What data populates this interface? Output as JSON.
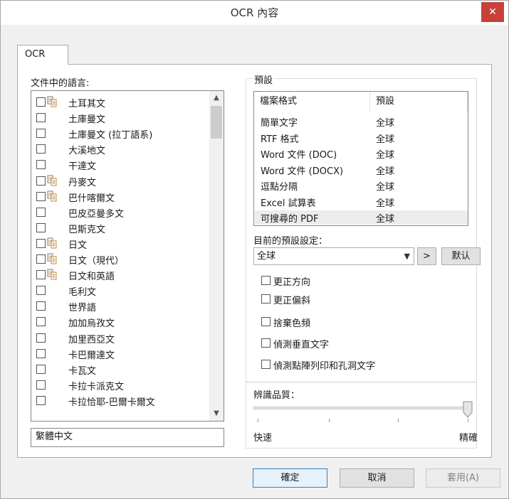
{
  "window": {
    "title": "OCR 內容"
  },
  "tabs": [
    {
      "label": "OCR"
    }
  ],
  "language_section": {
    "label": "文件中的語言:",
    "languages": [
      {
        "name": "土耳其文",
        "checked": false,
        "ocr_icon": true
      },
      {
        "name": "土庫曼文",
        "checked": false,
        "ocr_icon": false
      },
      {
        "name": "土庫曼文 (拉丁語系)",
        "checked": false,
        "ocr_icon": false
      },
      {
        "name": "大溪地文",
        "checked": false,
        "ocr_icon": false
      },
      {
        "name": "干達文",
        "checked": false,
        "ocr_icon": false
      },
      {
        "name": "丹麥文",
        "checked": false,
        "ocr_icon": true
      },
      {
        "name": "巴什喀爾文",
        "checked": false,
        "ocr_icon": true
      },
      {
        "name": "巴皮亞曼多文",
        "checked": false,
        "ocr_icon": false
      },
      {
        "name": "巴斯克文",
        "checked": false,
        "ocr_icon": false
      },
      {
        "name": "日文",
        "checked": false,
        "ocr_icon": true
      },
      {
        "name": "日文（現代）",
        "checked": false,
        "ocr_icon": true
      },
      {
        "name": "日文和英語",
        "checked": false,
        "ocr_icon": true
      },
      {
        "name": "毛利文",
        "checked": false,
        "ocr_icon": false
      },
      {
        "name": "世界語",
        "checked": false,
        "ocr_icon": false
      },
      {
        "name": "加加烏孜文",
        "checked": false,
        "ocr_icon": false
      },
      {
        "name": "加里西亞文",
        "checked": false,
        "ocr_icon": false
      },
      {
        "name": "卡巴爾達文",
        "checked": false,
        "ocr_icon": false
      },
      {
        "name": "卡瓦文",
        "checked": false,
        "ocr_icon": false
      },
      {
        "name": "卡拉卡派克文",
        "checked": false,
        "ocr_icon": false
      },
      {
        "name": "卡拉恰耶-巴爾卡爾文",
        "checked": false,
        "ocr_icon": false
      }
    ],
    "selected_languages": "繁體中文"
  },
  "preset_section": {
    "legend": "預設",
    "table": {
      "headers": [
        "檔案格式",
        "預設"
      ],
      "rows": [
        {
          "format": "簡單文字",
          "preset": "全球"
        },
        {
          "format": "RTF 格式",
          "preset": "全球"
        },
        {
          "format": "Word 文件 (DOC)",
          "preset": "全球"
        },
        {
          "format": "Word 文件 (DOCX)",
          "preset": "全球"
        },
        {
          "format": "逗點分隔",
          "preset": "全球"
        },
        {
          "format": "Excel 試算表",
          "preset": "全球"
        },
        {
          "format": "可搜尋的 PDF",
          "preset": "全球"
        }
      ],
      "selected_row": 6
    },
    "current_label": "目前的預設設定：",
    "current_value": "全球",
    "next_button": ">",
    "default_button": "默认",
    "options": [
      {
        "label": "更正方向",
        "checked": false
      },
      {
        "label": "更正偏斜",
        "checked": false
      },
      {
        "label": "捨棄色頻",
        "checked": false
      },
      {
        "label": "偵測垂直文字",
        "checked": false
      },
      {
        "label": "偵測點陣列印和孔洞文字",
        "checked": false
      }
    ],
    "quality": {
      "label": "辨識品質：",
      "min_label": "快速",
      "max_label": "精確",
      "value_fraction": 1.0
    }
  },
  "buttons": {
    "ok": "確定",
    "cancel": "取消",
    "apply": "套用(A)"
  }
}
